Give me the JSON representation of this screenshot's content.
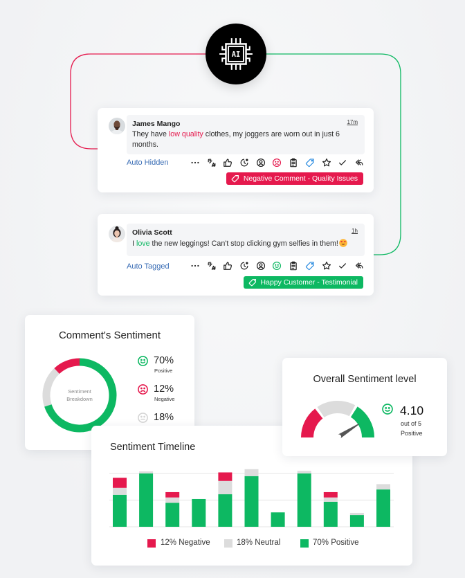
{
  "colors": {
    "negative": "#e5194d",
    "neutral": "#dcdcdc",
    "positive": "#0db862",
    "link": "#3a6db5",
    "tag_icon": "#2e8de0",
    "needle": "#555555"
  },
  "ai_hub": {
    "label": "AI"
  },
  "comments": [
    {
      "author": "James Mango",
      "time": "17m",
      "text_before": "They have ",
      "highlight": "low quality",
      "text_after": " clothes, my joggers are worn out in just 6 months.",
      "status": "Auto Hidden",
      "actions": [
        "more",
        "translate",
        "like",
        "history",
        "assign-user",
        "sentiment-negative",
        "notes",
        "tag",
        "star",
        "check",
        "reply"
      ],
      "tag": {
        "label": "Negative Comment - Quality Issues",
        "sentiment": "negative"
      }
    },
    {
      "author": "Olivia Scott",
      "time": "1h",
      "text_before": "I ",
      "highlight": "love",
      "text_after": " the new leggings! Can't stop clicking gym selfies in them!",
      "emoji": "heart-eyes",
      "status": "Auto Tagged",
      "actions": [
        "more",
        "translate",
        "like",
        "history",
        "assign-user",
        "sentiment-positive",
        "notes",
        "tag",
        "star",
        "check",
        "reply"
      ],
      "tag": {
        "label": "Happy Customer - Testimonial",
        "sentiment": "positive"
      }
    }
  ],
  "sentiment_card": {
    "title": "Comment's Sentiment",
    "center_label_line1": "Sentiment",
    "center_label_line2": "Breakdown",
    "items": [
      {
        "pct": "70%",
        "label": "Positive",
        "icon": "smile"
      },
      {
        "pct": "12%",
        "label": "Negative",
        "icon": "frown"
      },
      {
        "pct": "18%",
        "icon": "neutral"
      }
    ]
  },
  "overall": {
    "title": "Overall Sentiment level",
    "value": "4.10",
    "max": 5,
    "out_of": "out of 5",
    "label": "Positive",
    "zones": [
      {
        "name": "negative",
        "from": 0,
        "to": 0.3
      },
      {
        "name": "neutral",
        "from": 0.3,
        "to": 0.67
      },
      {
        "name": "positive",
        "from": 0.67,
        "to": 1
      }
    ]
  },
  "timeline": {
    "title": "Sentiment Timeline"
  },
  "chart_data": [
    {
      "type": "pie",
      "title": "Comment's Sentiment",
      "center_label": "Sentiment Breakdown",
      "categories": [
        "Positive",
        "Neutral",
        "Negative"
      ],
      "values": [
        70,
        18,
        12
      ],
      "unit": "%"
    },
    {
      "type": "bar",
      "stacked": true,
      "title": "Sentiment Timeline",
      "xlabel": "",
      "ylabel": "",
      "x": [
        1,
        2,
        3,
        4,
        5,
        6,
        7,
        8,
        9,
        10,
        11
      ],
      "ylim": [
        0,
        100
      ],
      "y_gridlines": [
        0,
        50,
        100
      ],
      "grid": true,
      "series": [
        {
          "name": "Positive",
          "color_key": "positive",
          "values": [
            60,
            100,
            45,
            52,
            61,
            95,
            27,
            100,
            47,
            22,
            70
          ]
        },
        {
          "name": "Neutral",
          "color_key": "neutral",
          "values": [
            13,
            4,
            10,
            0,
            25,
            13,
            0,
            5,
            8,
            4,
            10
          ]
        },
        {
          "name": "Negative",
          "color_key": "negative",
          "values": [
            19,
            0,
            10,
            0,
            16,
            0,
            0,
            0,
            10,
            0,
            0
          ]
        }
      ],
      "legend_position": "bottom",
      "legend": [
        {
          "label": "12% Negative",
          "color_key": "negative"
        },
        {
          "label": "18% Neutral",
          "color_key": "neutral"
        },
        {
          "label": "70% Positive",
          "color_key": "positive"
        }
      ]
    }
  ]
}
